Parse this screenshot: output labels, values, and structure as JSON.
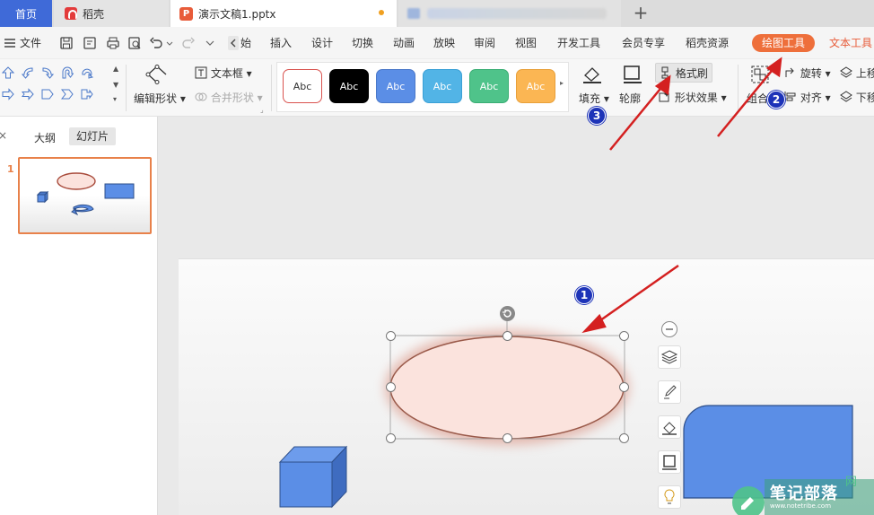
{
  "tabs": {
    "home": "首页",
    "daoke": "稻壳",
    "document": "演示文稿1.pptx",
    "add": "+"
  },
  "menu": {
    "file": "文件",
    "start": "始",
    "insert": "插入",
    "design": "设计",
    "transition": "切换",
    "animation": "动画",
    "slideshow": "放映",
    "review": "审阅",
    "view": "视图",
    "developer": "开发工具",
    "member": "会员专享",
    "resources": "稻壳资源",
    "drawing_tools": "绘图工具",
    "text_tools": "文本工具"
  },
  "ribbon": {
    "edit_shape": "编辑形状",
    "text_box": "文本框",
    "merge_shape": "合并形状",
    "styles": [
      {
        "label": "Abc",
        "fill": "#ffffff",
        "border": "#d9534f",
        "text": "#333333"
      },
      {
        "label": "Abc",
        "fill": "#000000",
        "border": "#000000",
        "text": "#ffffff"
      },
      {
        "label": "Abc",
        "fill": "#5b8ee6",
        "border": "#4a78c9",
        "text": "#ffffff"
      },
      {
        "label": "Abc",
        "fill": "#52b4e6",
        "border": "#3aa0d6",
        "text": "#ffffff"
      },
      {
        "label": "Abc",
        "fill": "#4fc38a",
        "border": "#3aae74",
        "text": "#ffffff"
      },
      {
        "label": "Abc",
        "fill": "#fbb653",
        "border": "#e8a03a",
        "text": "#ffffff"
      }
    ],
    "fill": "填充",
    "outline": "轮廓",
    "format_painter": "格式刷",
    "shape_effect": "形状效果",
    "group": "组合",
    "rotate": "旋转",
    "align": "对齐",
    "bring_up": "上移",
    "send_down": "下移"
  },
  "panel": {
    "outline_tab": "大纲",
    "slides_tab": "幻灯片",
    "slide_number": "1"
  },
  "badges": {
    "one": "1",
    "two": "2",
    "three": "3"
  },
  "watermark": {
    "text": "笔记部落",
    "url": "www.notetribe.com",
    "net": "网"
  },
  "colors": {
    "accent": "#ee6f3b",
    "home_tab": "#3f6ad8",
    "badge": "#1d33b8",
    "arrow": "#d42020",
    "shape_blue": "#5b8ee6",
    "ellipse_fill": "#fbe3dd"
  }
}
